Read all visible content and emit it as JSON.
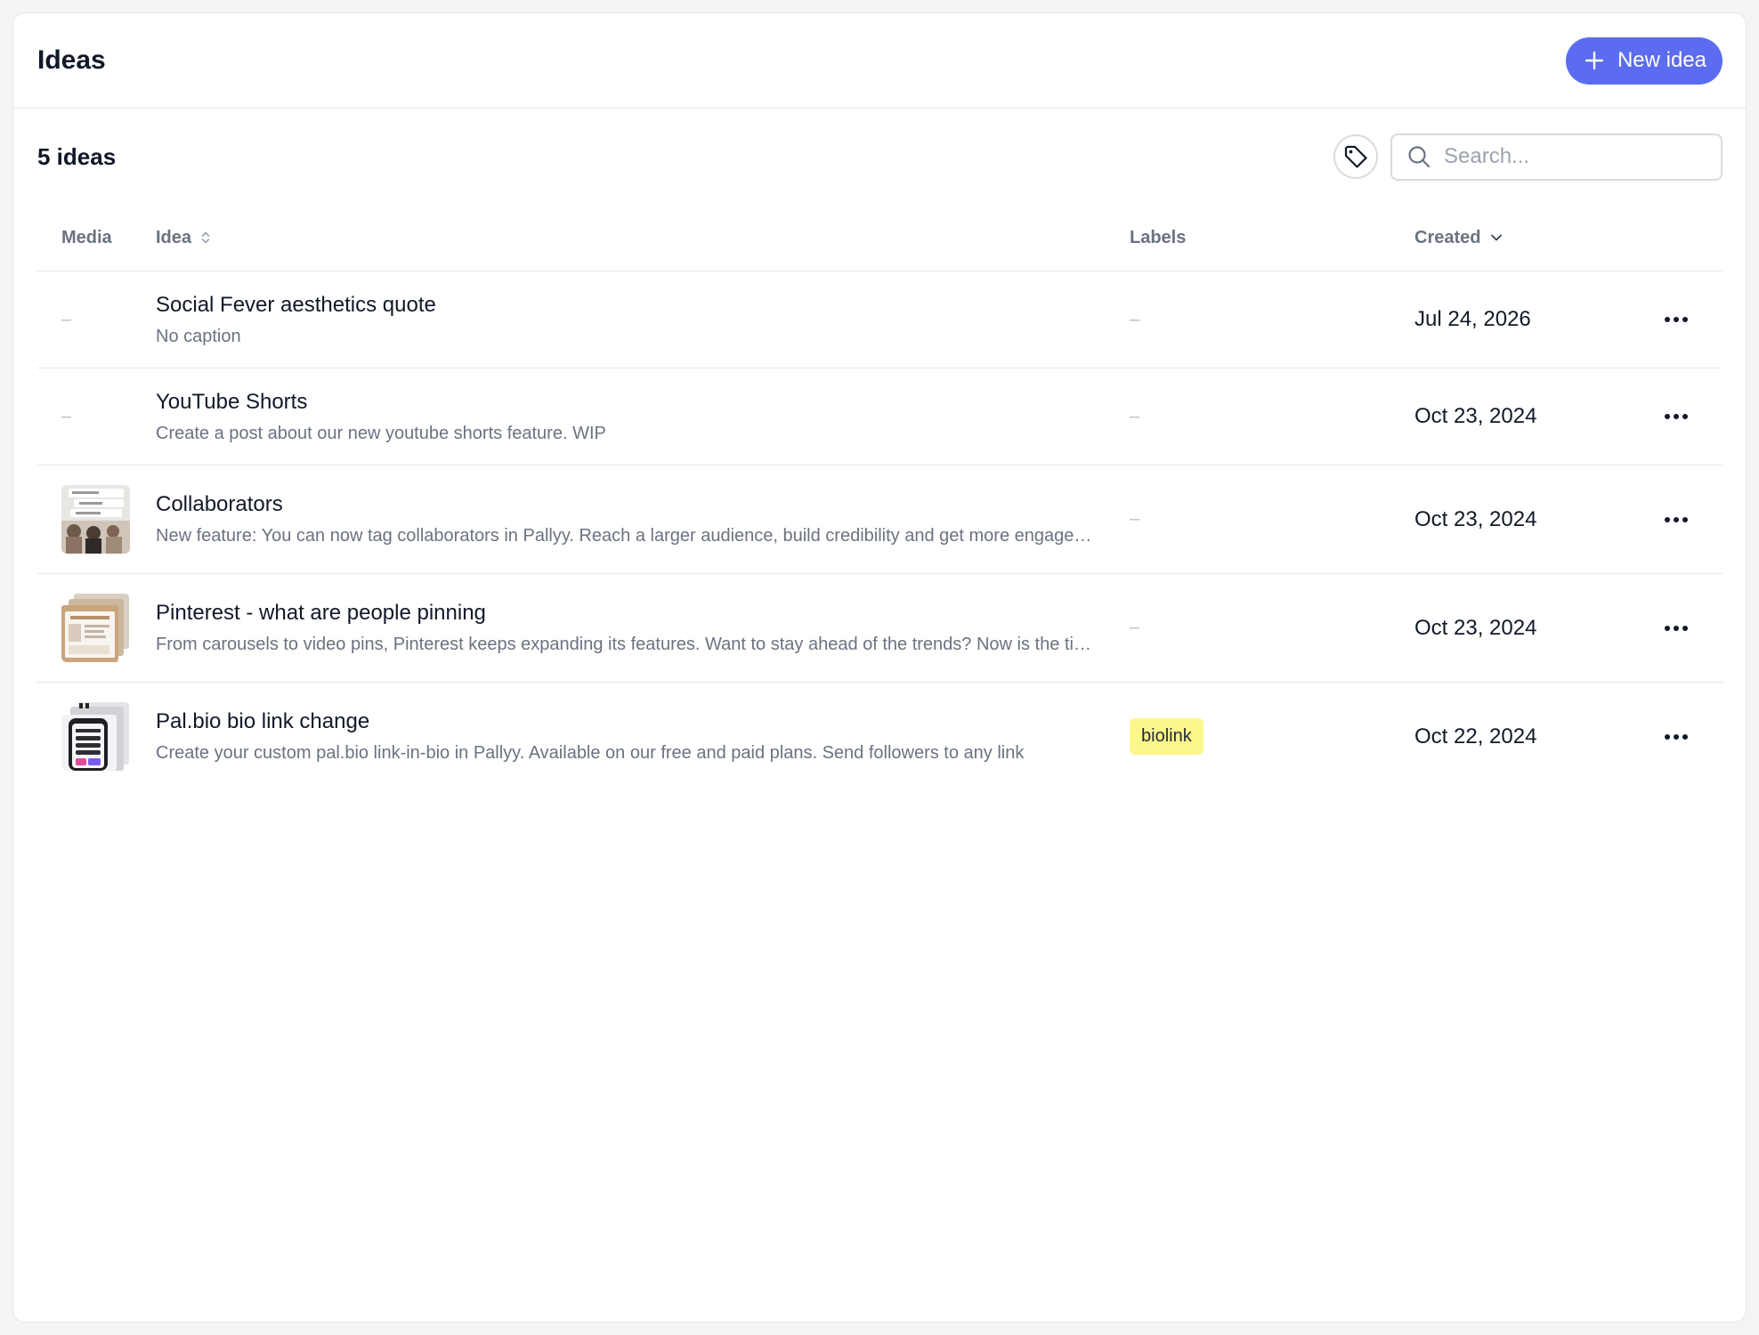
{
  "header": {
    "title": "Ideas",
    "new_button_label": "New idea",
    "accent_color": "#5b6cf0"
  },
  "toolbar": {
    "count_label": "5 ideas",
    "search_placeholder": "Search...",
    "tag_icon": "tag-icon",
    "search_icon": "search-icon"
  },
  "table": {
    "columns": {
      "media": "Media",
      "idea": "Idea",
      "labels": "Labels",
      "created": "Created"
    },
    "empty_value": "–",
    "rows": [
      {
        "media": "none",
        "title": "Social Fever aesthetics quote",
        "caption": "No caption",
        "label": "–",
        "created": "Jul 24, 2026"
      },
      {
        "media": "none",
        "title": "YouTube Shorts",
        "caption": "Create a post about our new youtube shorts feature. WIP",
        "label": "–",
        "created": "Oct 23, 2024"
      },
      {
        "media": "image",
        "title": "Collaborators",
        "caption": "New feature: You can now tag collaborators in Pallyy. Reach a larger audience, build credibility and get more engagement",
        "label": "–",
        "created": "Oct 23, 2024"
      },
      {
        "media": "image",
        "title": "Pinterest - what are people pinning",
        "caption": "From carousels to video pins, Pinterest keeps expanding its features. Want to stay ahead of the trends? Now is the time",
        "label": "–",
        "created": "Oct 23, 2024"
      },
      {
        "media": "image",
        "title": "Pal.bio bio link change",
        "caption": "Create your custom pal.bio link-in-bio in Pallyy. Available on our free and paid plans. Send followers to any link",
        "label": "biolink",
        "label_color": "#fdf68a",
        "created": "Oct 22, 2024"
      }
    ]
  }
}
